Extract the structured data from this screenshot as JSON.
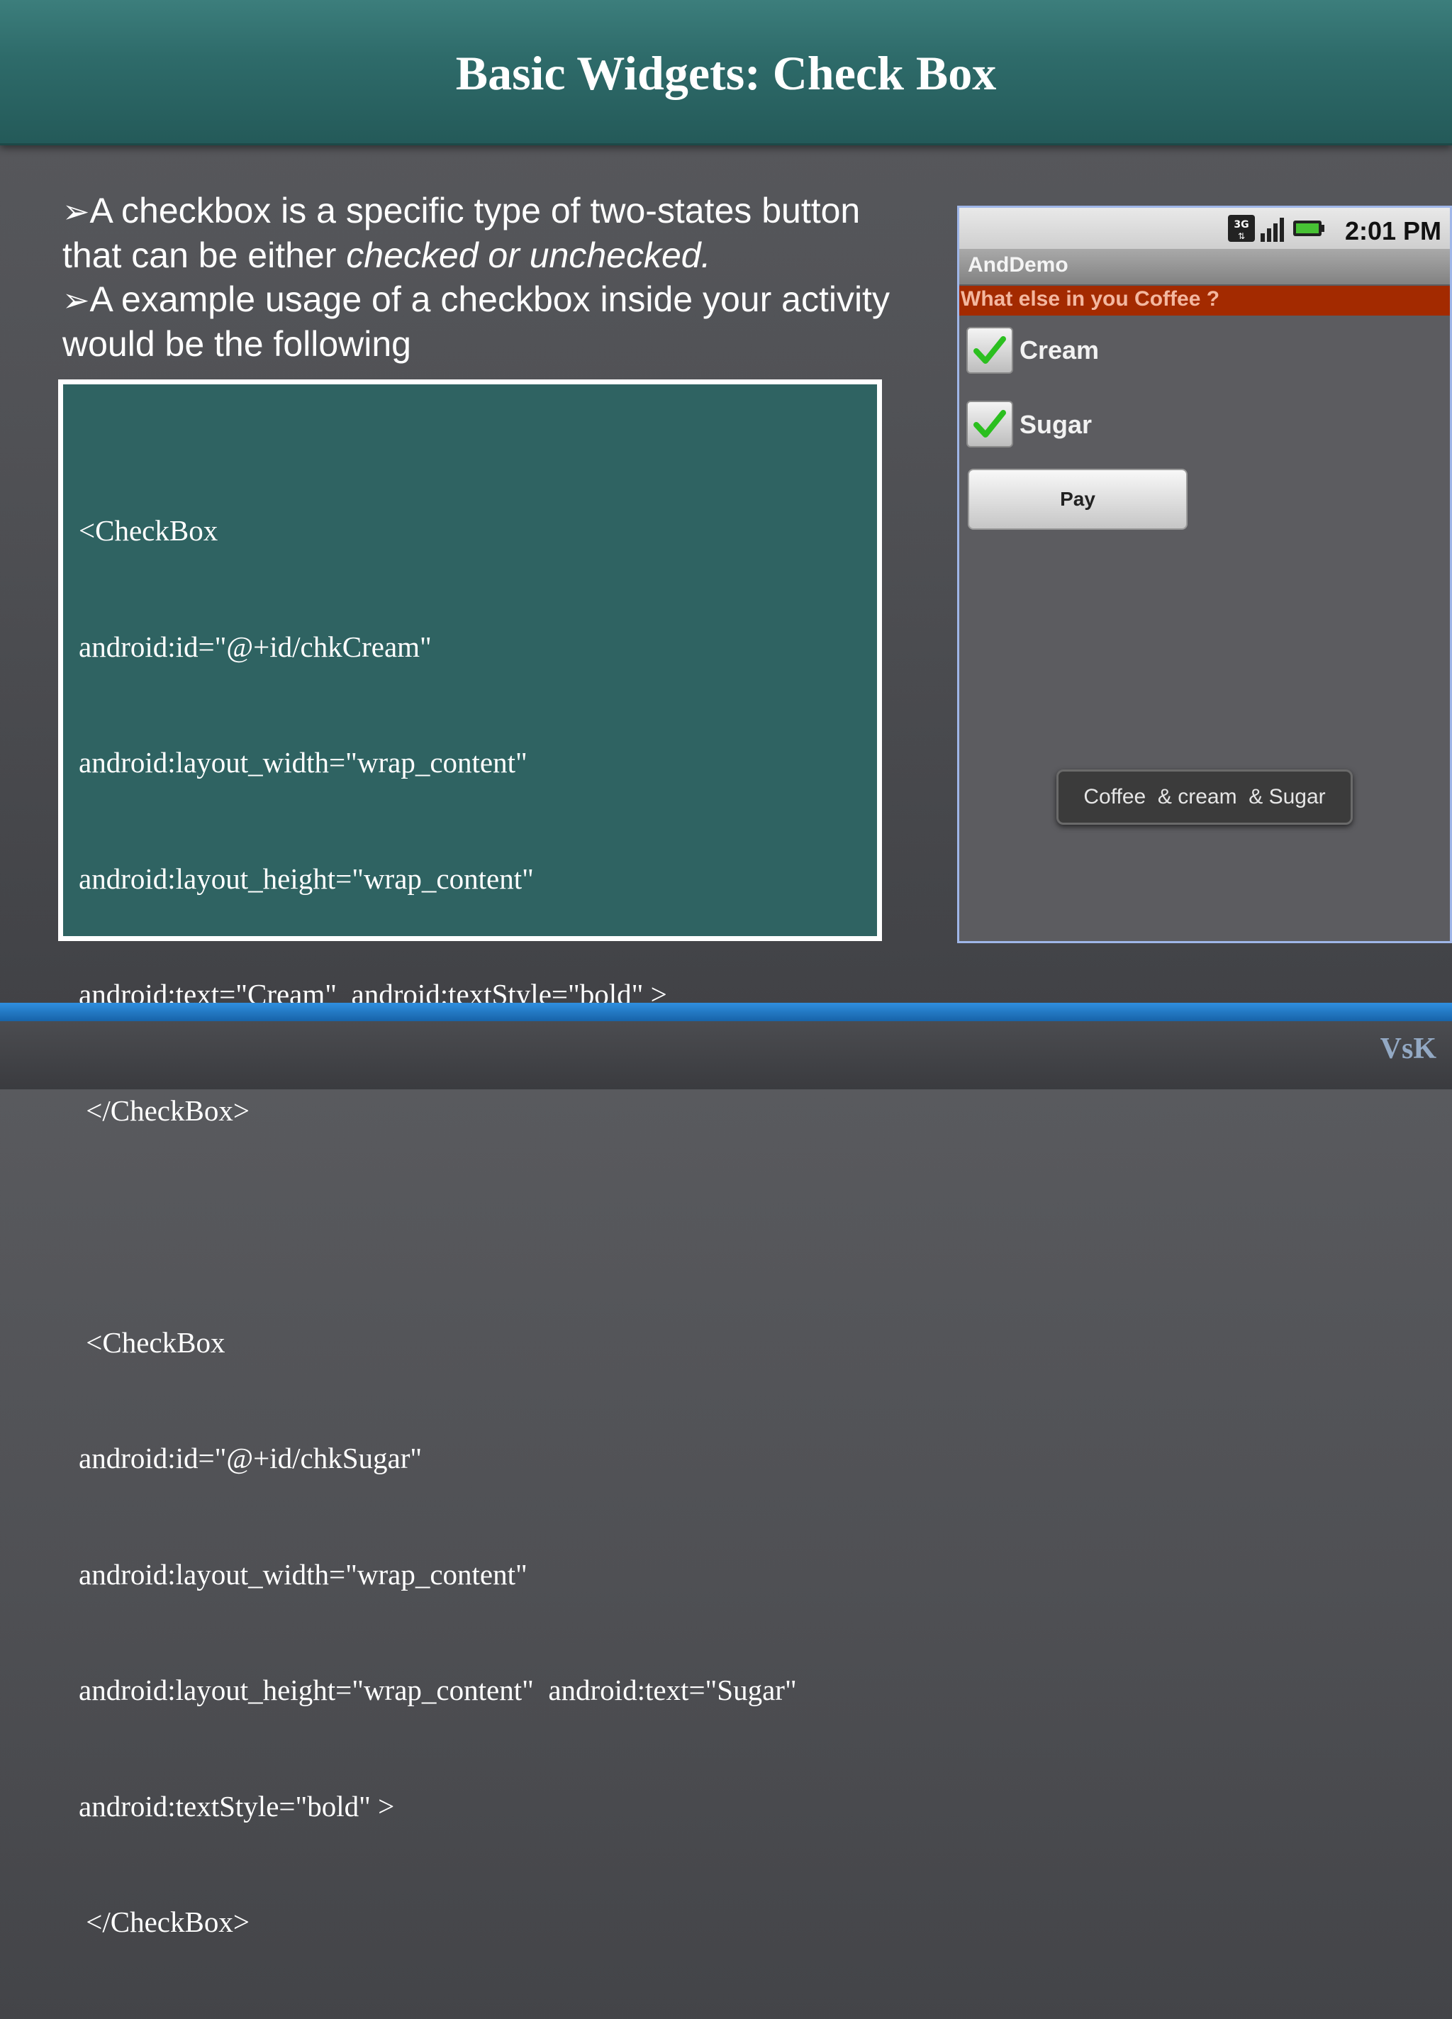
{
  "slide": {
    "title": "Basic Widgets: Check Box",
    "bullets": [
      {
        "arrow": "➢",
        "text": "A checkbox is a specific type of two-states button that can be either ",
        "italic": "checked or unchecked."
      },
      {
        "arrow": "➢",
        "text": "A example usage of a checkbox inside your activity would be the following",
        "italic": ""
      }
    ],
    "code_lines": [
      "<CheckBox",
      "android:id=\"@+id/chkCream\"",
      "android:layout_width=\"wrap_content\"",
      "android:layout_height=\"wrap_content\"",
      "android:text=\"Cream\"  android:textStyle=\"bold\" >",
      " </CheckBox>",
      "",
      " <CheckBox",
      "android:id=\"@+id/chkSugar\"",
      "android:layout_width=\"wrap_content\"",
      "android:layout_height=\"wrap_content\"  android:text=\"Sugar\"",
      "android:textStyle=\"bold\" >",
      " </CheckBox>"
    ],
    "logo": "VsK"
  },
  "phone": {
    "status": {
      "network": "3G",
      "time": "2:01 PM"
    },
    "app_title": "AndDemo",
    "prompt": "What else in you Coffee ?",
    "checkboxes": [
      {
        "label": "Cream",
        "checked": true
      },
      {
        "label": "Sugar",
        "checked": true
      }
    ],
    "pay_button": "Pay",
    "toast": "Coffee  & cream  & Sugar"
  },
  "colors": {
    "title_bar": "#2e6b6a",
    "code_box": "#2f6362",
    "prompt_bar": "#a32a00",
    "check_green": "#2bbf1f",
    "footer_accent": "#1f78c8"
  }
}
